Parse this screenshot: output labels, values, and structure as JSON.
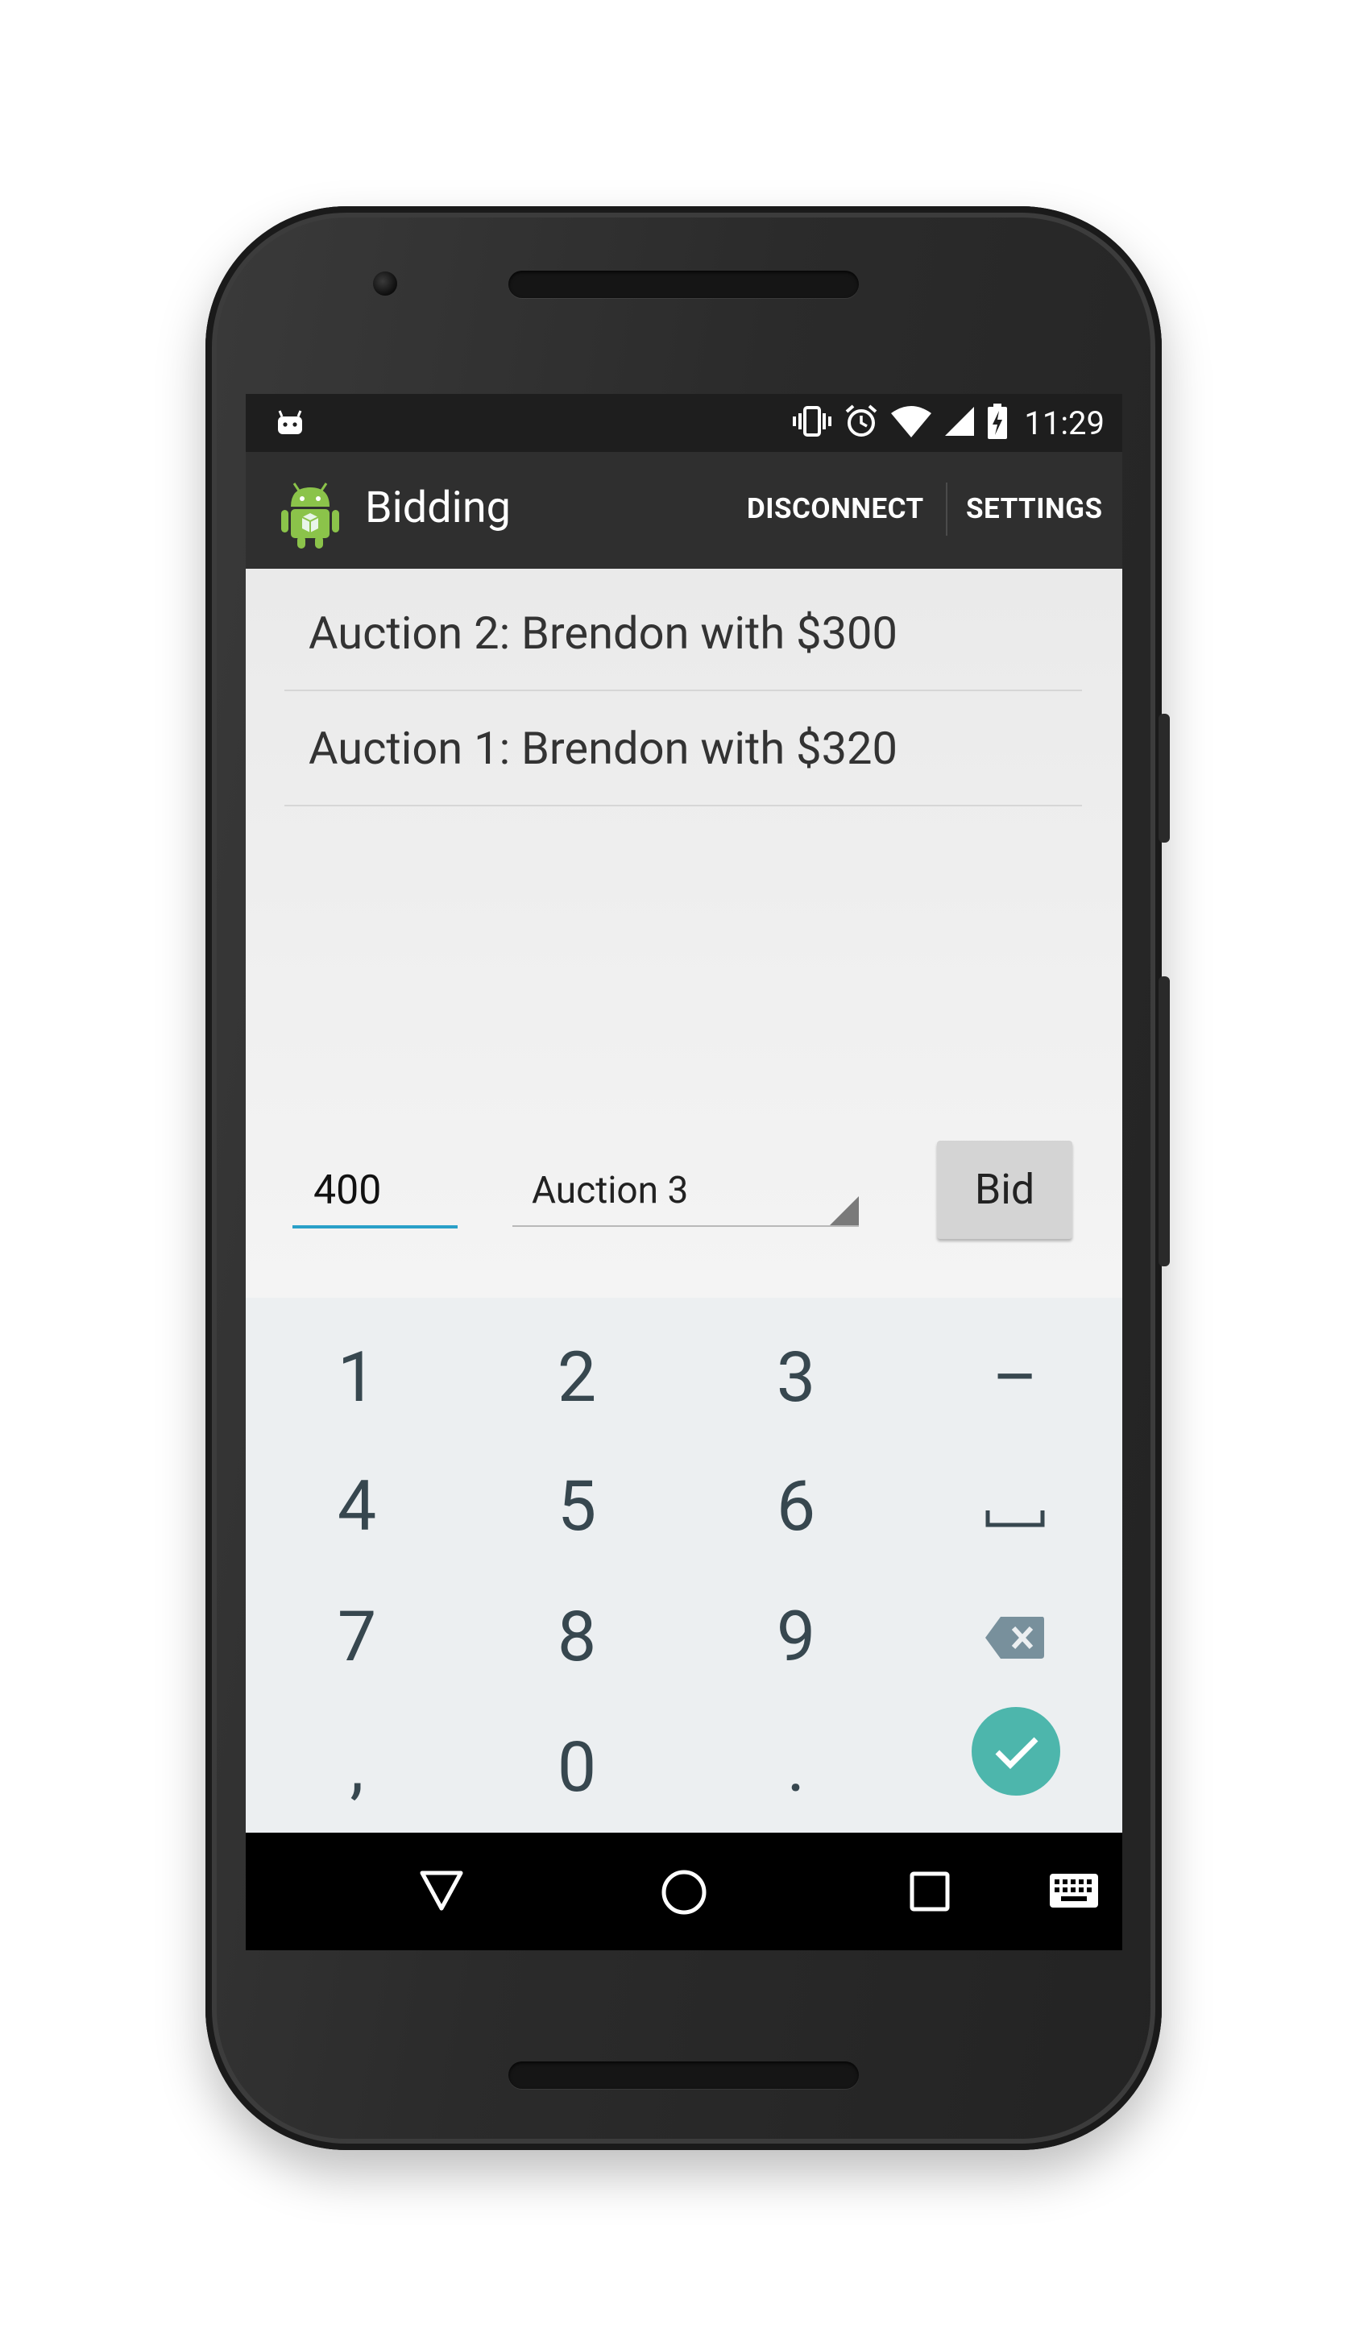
{
  "status_bar": {
    "time": "11:29",
    "icons": [
      "android-debug-icon",
      "vibrate-icon",
      "alarm-icon",
      "wifi-icon",
      "cell-signal-icon",
      "battery-charging-icon"
    ]
  },
  "action_bar": {
    "app_icon": "android-app-icon",
    "title": "Bidding",
    "actions": [
      "DISCONNECT",
      "SETTINGS"
    ]
  },
  "bids": [
    "Auction 2: Brendon with $300",
    "Auction 1: Brendon with $320"
  ],
  "form": {
    "amount_value": "400",
    "auction_selected": "Auction 3",
    "bid_label": "Bid"
  },
  "keyboard": {
    "keys": [
      "1",
      "2",
      "3",
      "–",
      "4",
      "5",
      "6",
      "space",
      "7",
      "8",
      "9",
      "backspace",
      ",",
      "0",
      ".",
      " done"
    ],
    "accent": "#4db6ac"
  },
  "nav": [
    "back-icon",
    "home-icon",
    "recents-icon",
    "keyboard-switch-icon"
  ],
  "colors": {
    "accent_underline": "#2aa0c8",
    "action_bar": "#2f2f2f",
    "status_bar": "#1e1e1e"
  }
}
